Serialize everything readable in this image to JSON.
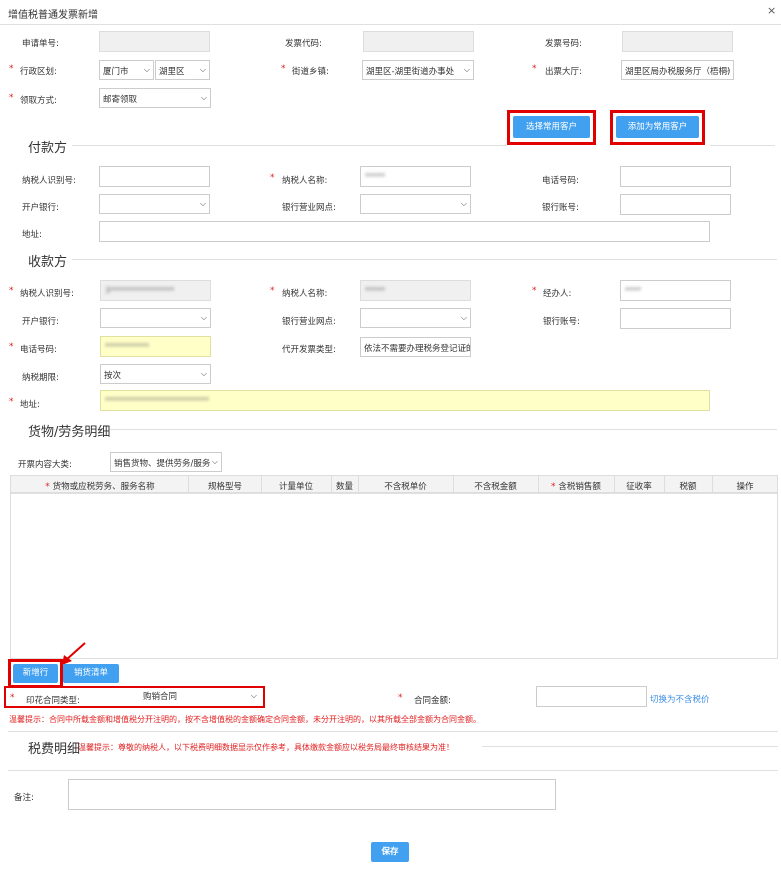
{
  "window": {
    "title": "增值税普通发票新增",
    "close": "×"
  },
  "top": {
    "apply_no_label": "申请单号:",
    "invoice_code_label": "发票代码:",
    "invoice_no_label": "发票号码:",
    "district_label": "行政区划:",
    "city_value": "厦门市",
    "district_value": "湖里区",
    "street_label": "街道乡镇:",
    "street_value": "湖里区-湖里街道办事处",
    "hall_label": "出票大厅:",
    "hall_value": "湖里区局办税服务厅（梧桐)",
    "receive_label": "领取方式:",
    "receive_value": "邮寄领取",
    "select_customer_btn": "选择常用客户",
    "add_customer_btn": "添加为常用客户"
  },
  "payer": {
    "section_title": "付款方",
    "taxid_label": "纳税人识别号:",
    "name_label": "纳税人名称:",
    "name_value": "*****",
    "phone_label": "电话号码:",
    "bank_label": "开户银行:",
    "branch_label": "银行营业网点:",
    "account_label": "银行账号:",
    "address_label": "地址:"
  },
  "payee": {
    "section_title": "收款方",
    "taxid_label": "纳税人识别号:",
    "taxid_value": "3****************",
    "name_label": "纳税人名称:",
    "name_value": "*****",
    "agent_label": "经办人:",
    "agent_value": "****",
    "bank_label": "开户银行:",
    "branch_label": "银行营业网点:",
    "account_label": "银行账号:",
    "phone_label": "电话号码:",
    "phone_value": "***********",
    "type_label": "代开发票类型:",
    "type_value": "依法不需要办理税务登记证的",
    "period_label": "纳税期限:",
    "period_value": "按次",
    "address_label": "地址:",
    "address_value": "**************************"
  },
  "goods": {
    "section_title": "货物/劳务明细",
    "category_label": "开票内容大类:",
    "category_value": "销售货物、提供劳务/服务",
    "columns": [
      "货物或应税劳务、服务名称",
      "规格型号",
      "计量单位",
      "数量",
      "不含税单价",
      "不含税金额",
      "含税销售额",
      "征收率",
      "税额",
      "操作"
    ],
    "add_row_btn": "新增行",
    "sales_list_btn": "销货清单",
    "contract_type_label": "印花合同类型:",
    "contract_type_value": "购销合同",
    "contract_amount_label": "合同金额:",
    "switch_link": "切换为不含税价",
    "hint1": "温馨提示：合同中所载金额和增值税分开注明的，按不含增值税的金额确定合同金额，未分开注明的，以其所载全部金额为合同金额。"
  },
  "tax": {
    "section_title": "税费明细",
    "hint2": "温馨提示：尊敬的纳税人，以下税费明细数据显示仅作参考，具体缴款金额应以税务局最终审核结果为准！"
  },
  "remark_label": "备注:",
  "save_btn": "保存",
  "colors": {
    "accent": "#41a0f0",
    "required": "#e02020",
    "highlight_box": "#e00000",
    "yellow_field": "#ffffc8"
  }
}
